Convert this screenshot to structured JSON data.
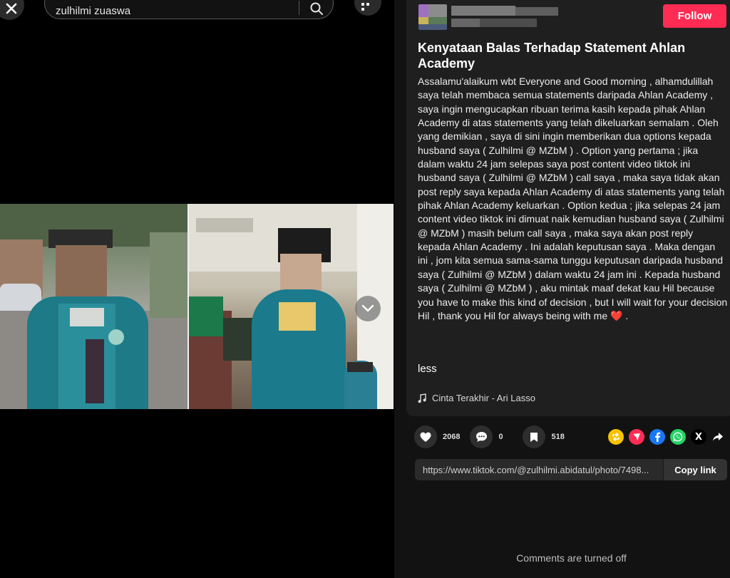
{
  "search": {
    "value": "zulhilmi zuaswa"
  },
  "post": {
    "follow_label": "Follow",
    "title": "Kenyataan Balas Terhadap Statement Ahlan Academy",
    "description": "Assalamu'alaikum wbt Everyone and Good morning , alhamdulillah saya telah membaca semua statements daripada Ahlan Academy , saya ingin mengucapkan ribuan terima kasih kepada pihak Ahlan Academy di atas statements yang telah dikeluarkan semalam . Oleh yang demikian , saya di sini ingin memberikan dua options kepada husband saya ( Zulhilmi @ MZbM ) . Option yang pertama ; jika dalam waktu 24 jam selepas saya post content video tiktok ini husband saya ( Zulhilmi @ MZbM ) call saya , maka saya tidak akan post reply saya kepada Ahlan Academy di atas statements yang telah pihak Ahlan Academy keluarkan . Option kedua ; jika selepas 24 jam content video tiktok ini dimuat naik kemudian husband saya ( Zulhilmi @ MZbM ) masih belum call saya , maka saya akan post reply kepada Ahlan Academy . Ini adalah keputusan saya . Maka dengan ini , jom kita semua sama-sama tunggu keputusan daripada husband saya ( Zulhilmi @ MZbM ) dalam waktu 24 jam ini . Kepada husband saya ( Zulhilmi @ MZbM ) , aku mintak maaf dekat kau Hil because you have to make this kind of decision , but I will wait for your decision Hil , thank you Hil for always being with me",
    "description_emoji": "❤️",
    "description_end": " .",
    "less_label": "less",
    "music": "Cinta Terakhir - Ari Lasso"
  },
  "stats": {
    "likes": "2068",
    "comments": "0",
    "saves": "518"
  },
  "share": {
    "link": "https://www.tiktok.com/@zulhilmi.abidatul/photo/7498...",
    "copy_label": "Copy link",
    "x_glyph": "X"
  },
  "comments_status": "Comments are turned off",
  "colors": {
    "follow": "#fe2c55",
    "repost": "#f7c300",
    "send": "#fe2c55",
    "facebook": "#1877f2",
    "whatsapp": "#25d366",
    "x": "#000000"
  }
}
